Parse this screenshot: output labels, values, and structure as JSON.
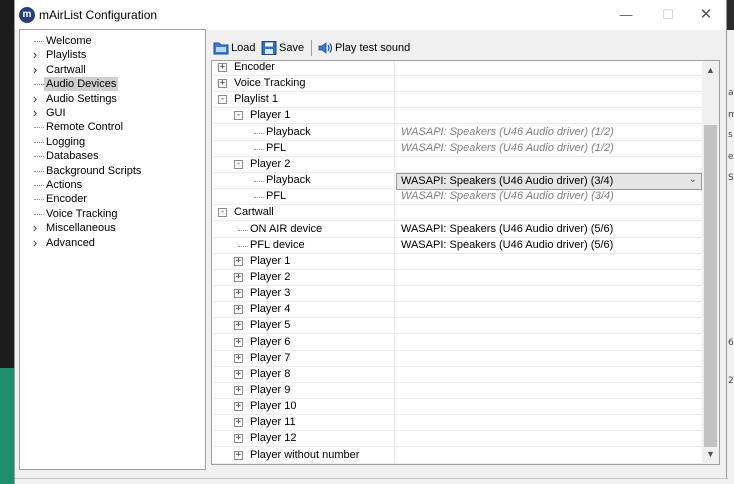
{
  "window": {
    "title": "mAirList Configuration",
    "icon": "mairlist-logo-icon"
  },
  "nav": {
    "items": [
      {
        "label": "Welcome",
        "expandable": false,
        "selected": false
      },
      {
        "label": "Playlists",
        "expandable": true,
        "selected": false
      },
      {
        "label": "Cartwall",
        "expandable": true,
        "selected": false
      },
      {
        "label": "Audio Devices",
        "expandable": false,
        "selected": true
      },
      {
        "label": "Audio Settings",
        "expandable": true,
        "selected": false
      },
      {
        "label": "GUI",
        "expandable": true,
        "selected": false
      },
      {
        "label": "Remote Control",
        "expandable": false,
        "selected": false
      },
      {
        "label": "Logging",
        "expandable": false,
        "selected": false
      },
      {
        "label": "Databases",
        "expandable": false,
        "selected": false
      },
      {
        "label": "Background Scripts",
        "expandable": false,
        "selected": false
      },
      {
        "label": "Actions",
        "expandable": false,
        "selected": false
      },
      {
        "label": "Encoder",
        "expandable": false,
        "selected": false
      },
      {
        "label": "Voice Tracking",
        "expandable": false,
        "selected": false
      },
      {
        "label": "Miscellaneous",
        "expandable": true,
        "selected": false
      },
      {
        "label": "Advanced",
        "expandable": true,
        "selected": false
      }
    ]
  },
  "toolbar": {
    "load_label": "Load",
    "save_label": "Save",
    "play_label": "Play test sound"
  },
  "grid": {
    "rows": [
      {
        "label": "Encoder",
        "toggle": "+",
        "level": 0,
        "value": "",
        "muted": false
      },
      {
        "label": "Voice Tracking",
        "toggle": "+",
        "level": 0,
        "value": "",
        "muted": false
      },
      {
        "label": "Playlist 1",
        "toggle": "−",
        "level": 0,
        "value": "",
        "muted": false
      },
      {
        "label": "Player 1",
        "toggle": "−",
        "level": 1,
        "value": "",
        "muted": false
      },
      {
        "label": "Playback",
        "toggle": "",
        "level": 2,
        "value": "WASAPI: Speakers (U46 Audio driver) (1/2)",
        "muted": true
      },
      {
        "label": "PFL",
        "toggle": "",
        "level": 2,
        "value": "WASAPI: Speakers (U46 Audio driver) (1/2)",
        "muted": true
      },
      {
        "label": "Player 2",
        "toggle": "−",
        "level": 1,
        "value": "",
        "muted": false
      },
      {
        "label": "Playback",
        "toggle": "",
        "level": 2,
        "value": "WASAPI: Speakers (U46 Audio driver) (3/4)",
        "muted": false,
        "dropdown": true
      },
      {
        "label": "PFL",
        "toggle": "",
        "level": 2,
        "value": "WASAPI: Speakers (U46 Audio driver) (3/4)",
        "muted": true
      },
      {
        "label": "Cartwall",
        "toggle": "−",
        "level": 0,
        "value": "",
        "muted": false
      },
      {
        "label": "ON AIR device",
        "toggle": "",
        "level": 1,
        "value": "WASAPI: Speakers (U46 Audio driver) (5/6)",
        "muted": false
      },
      {
        "label": "PFL device",
        "toggle": "",
        "level": 1,
        "value": "WASAPI: Speakers (U46 Audio driver) (5/6)",
        "muted": false
      },
      {
        "label": "Player 1",
        "toggle": "+",
        "level": 1,
        "value": "",
        "muted": false
      },
      {
        "label": "Player 2",
        "toggle": "+",
        "level": 1,
        "value": "",
        "muted": false
      },
      {
        "label": "Player 3",
        "toggle": "+",
        "level": 1,
        "value": "",
        "muted": false
      },
      {
        "label": "Player 4",
        "toggle": "+",
        "level": 1,
        "value": "",
        "muted": false
      },
      {
        "label": "Player 5",
        "toggle": "+",
        "level": 1,
        "value": "",
        "muted": false
      },
      {
        "label": "Player 6",
        "toggle": "+",
        "level": 1,
        "value": "",
        "muted": false
      },
      {
        "label": "Player 7",
        "toggle": "+",
        "level": 1,
        "value": "",
        "muted": false
      },
      {
        "label": "Player 8",
        "toggle": "+",
        "level": 1,
        "value": "",
        "muted": false
      },
      {
        "label": "Player 9",
        "toggle": "+",
        "level": 1,
        "value": "",
        "muted": false
      },
      {
        "label": "Player 10",
        "toggle": "+",
        "level": 1,
        "value": "",
        "muted": false
      },
      {
        "label": "Player 11",
        "toggle": "+",
        "level": 1,
        "value": "",
        "muted": false
      },
      {
        "label": "Player 12",
        "toggle": "+",
        "level": 1,
        "value": "",
        "muted": false
      },
      {
        "label": "Player without number",
        "toggle": "+",
        "level": 1,
        "value": "",
        "muted": false
      }
    ]
  },
  "background_fragments": [
    "a",
    "m",
    "s",
    "e",
    "S",
    "6",
    "2"
  ],
  "colors": {
    "selection": "#cfcfcf",
    "muted_text": "#808080",
    "dropdown_bg": "#e5e5e5"
  }
}
